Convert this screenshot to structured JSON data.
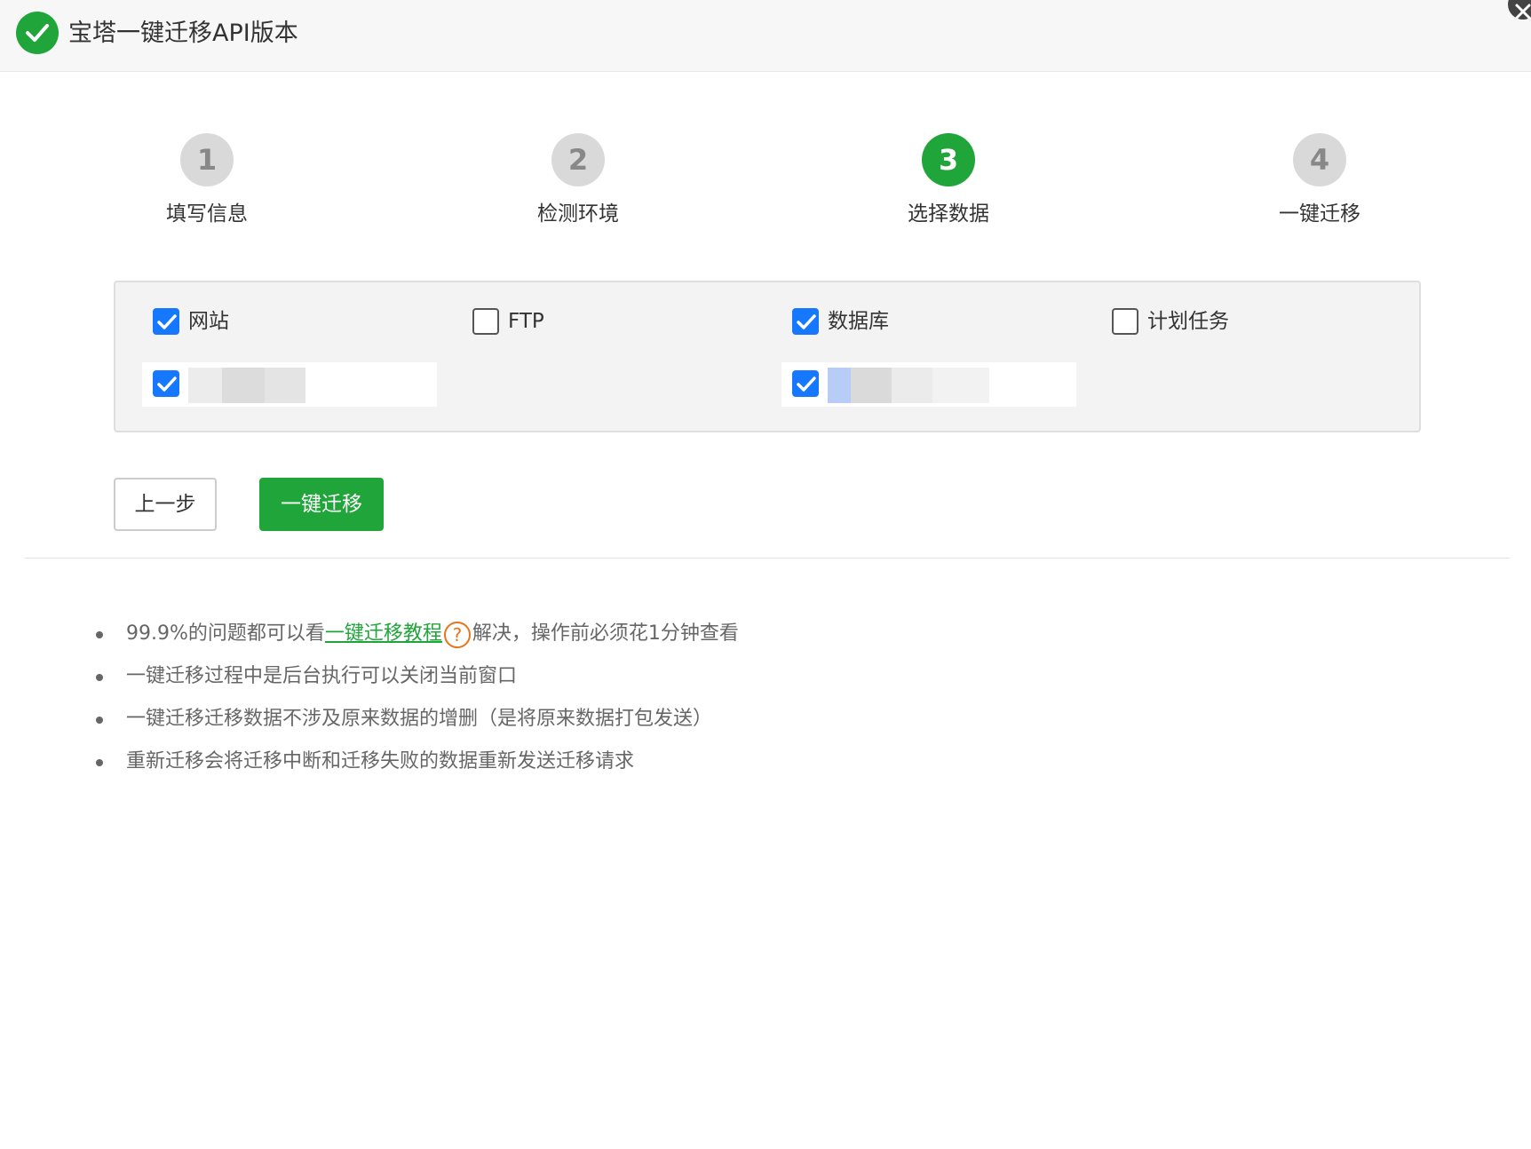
{
  "window": {
    "title": "宝塔一键迁移API版本",
    "app_icon": "check-circle-icon",
    "close_icon": "close-icon"
  },
  "steps": [
    {
      "number": "1",
      "label": "填写信息",
      "active": false
    },
    {
      "number": "2",
      "label": "检测环境",
      "active": false
    },
    {
      "number": "3",
      "label": "选择数据",
      "active": true
    },
    {
      "number": "4",
      "label": "一键迁移",
      "active": false
    }
  ],
  "selection": {
    "categories": [
      {
        "label": "网站",
        "checked": true
      },
      {
        "label": "FTP",
        "checked": false
      },
      {
        "label": "数据库",
        "checked": true
      },
      {
        "label": "计划任务",
        "checked": false
      }
    ],
    "website_items": [
      {
        "checked": true
      }
    ],
    "database_items": [
      {
        "checked": true
      }
    ]
  },
  "buttons": {
    "prev_label": "上一步",
    "start_label": "一键迁移"
  },
  "tips": {
    "tip1_before": "99.9%的问题都可以看",
    "tip1_link": "一键迁移教程",
    "tip1_help": "?",
    "tip1_after": "解决，操作前必须花1分钟查看",
    "tip2": "一键迁移过程中是后台执行可以关闭当前窗口",
    "tip3": "一键迁移迁移数据不涉及原来数据的增删（是将原来数据打包发送）",
    "tip4": "重新迁移会将迁移中断和迁移失败的数据重新发送迁移请求"
  },
  "colors": {
    "brand_green": "#20a53a",
    "checkbox_blue": "#1677ff",
    "step_inactive": "#d9d9d9",
    "help_orange": "#e8741a"
  }
}
